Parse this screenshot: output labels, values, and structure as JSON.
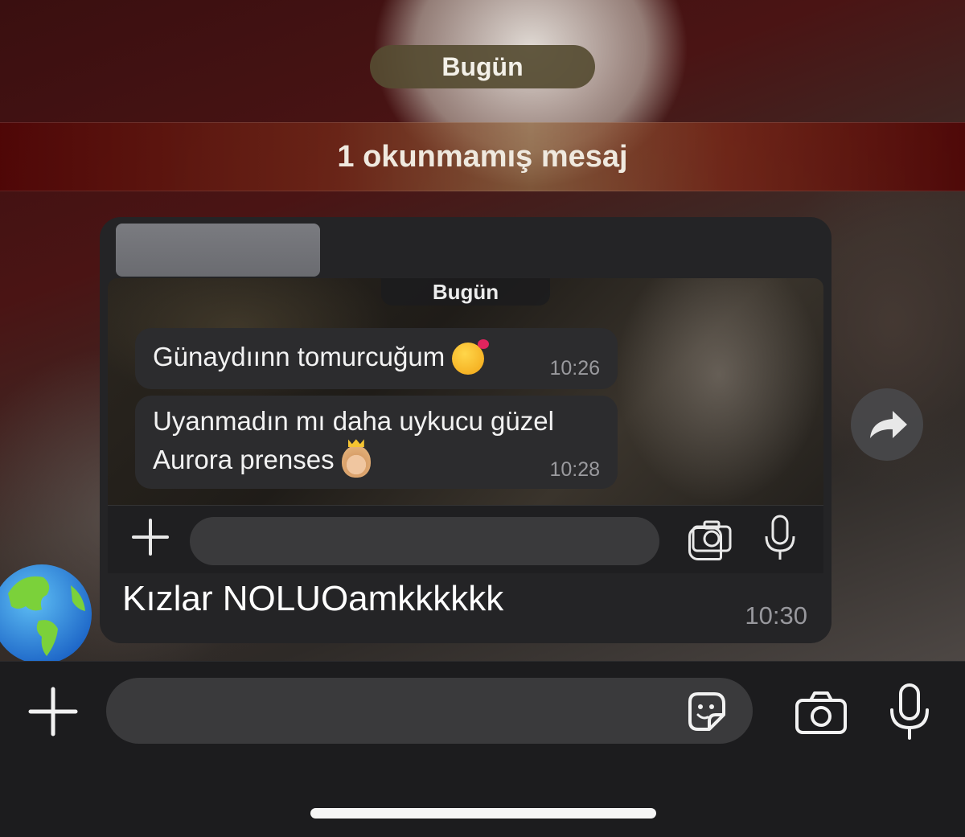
{
  "chat": {
    "date_label": "Bugün",
    "unread_banner": "1 okunmamış mesaj"
  },
  "message": {
    "screenshot": {
      "date_label": "Bugün",
      "messages": [
        {
          "text": "Günaydıınn tomurcuğum",
          "emoji": "smiling-face-with-hearts",
          "time": "10:26"
        },
        {
          "line1": "Uyanmadın mı daha uykucu güzel",
          "line2": "Aurora prenses",
          "emoji": "princess",
          "time": "10:28"
        }
      ]
    },
    "text": "Kızlar NOLUOamkkkkkk",
    "time": "10:30"
  },
  "input_bar": {
    "placeholder": ""
  },
  "colors": {
    "background": "#1c1c1e",
    "bubble": "#242426",
    "field": "#3a3a3c",
    "unread_banner": "#5a0c0c"
  },
  "icons": [
    "plus-icon",
    "sticker-icon",
    "camera-icon",
    "microphone-icon",
    "forward-icon",
    "globe-avatar"
  ]
}
